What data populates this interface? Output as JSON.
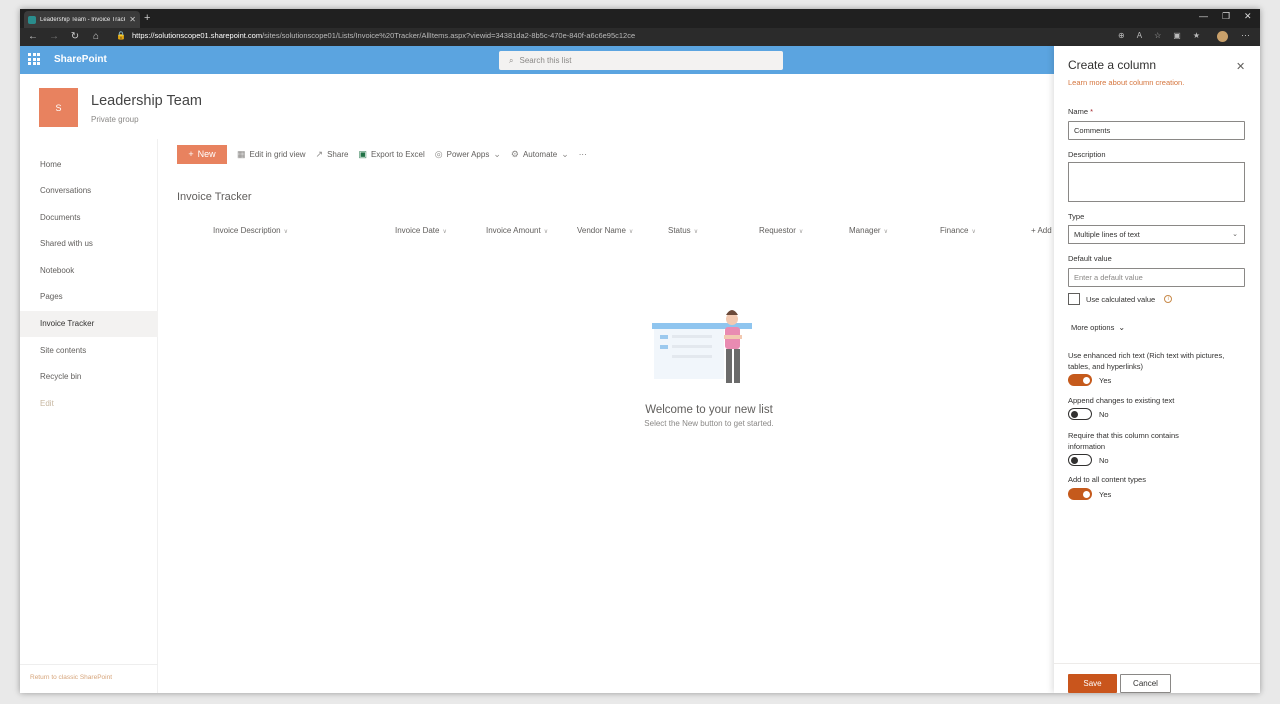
{
  "browser": {
    "tab_title": "Leadership Team - Invoice Tracker",
    "url_host": "https://solutionscope01.sharepoint.com",
    "url_path": "/sites/solutionscope01/Lists/Invoice%20Tracker/AllItems.aspx?viewid=34381da2-8b5c-470e-840f-a6c6e95c12ce"
  },
  "suite": {
    "brand": "SharePoint",
    "search_placeholder": "Search this list"
  },
  "site": {
    "logo_letter": "S",
    "title": "Leadership Team",
    "subtitle": "Private group"
  },
  "left_nav": {
    "items": [
      "Home",
      "Conversations",
      "Documents",
      "Shared with us",
      "Notebook",
      "Pages",
      "Invoice Tracker",
      "Site contents",
      "Recycle bin",
      "Edit"
    ],
    "selected": "Invoice Tracker",
    "footer_link": "Return to classic SharePoint"
  },
  "command_bar": {
    "new": "New",
    "edit_grid": "Edit in grid view",
    "share": "Share",
    "export": "Export to Excel",
    "power_apps": "Power Apps",
    "automate": "Automate",
    "more": "···"
  },
  "list": {
    "title": "Invoice Tracker",
    "columns": [
      "Invoice Description",
      "Invoice Date",
      "Invoice Amount",
      "Vendor Name",
      "Status",
      "Requestor",
      "Manager",
      "Finance",
      "+ Add"
    ],
    "empty_title": "Welcome to your new list",
    "empty_sub": "Select the New button to get started."
  },
  "panel": {
    "title": "Create a column",
    "learn_more": "Learn more about column creation.",
    "name_label": "Name",
    "name_required": "*",
    "name_value": "Comments",
    "description_label": "Description",
    "type_label": "Type",
    "type_value": "Multiple lines of text",
    "default_label": "Default value",
    "default_placeholder": "Enter a default value",
    "calc_label": "Use calculated value",
    "more_options": "More options",
    "rich_text_label": "Use enhanced rich text (Rich text with pictures, tables, and hyperlinks)",
    "rich_text_value": "Yes",
    "append_label": "Append changes to existing text",
    "append_value": "No",
    "require_label": "Require that this column contains information",
    "require_value": "No",
    "add_all_label": "Add to all content types",
    "add_all_value": "Yes",
    "save": "Save",
    "cancel": "Cancel"
  },
  "colors": {
    "suite_bar": "#5ba4e0",
    "accent": "#e8825f",
    "toggle_on": "#c55a1c",
    "save_button": "#c9551c"
  }
}
